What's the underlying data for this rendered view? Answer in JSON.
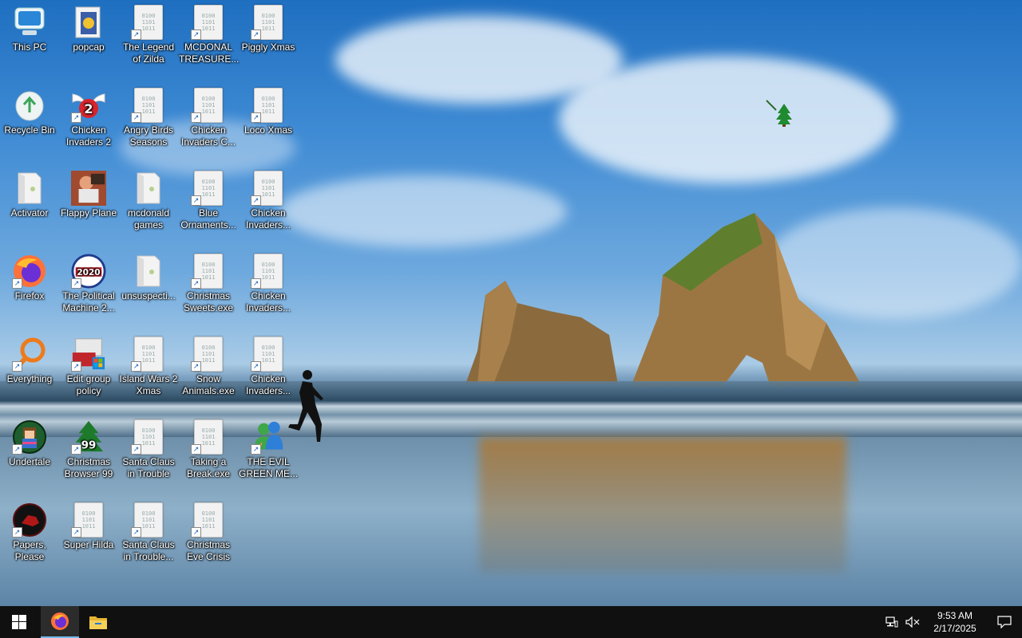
{
  "desktop": {
    "icons": [
      {
        "label": "This PC",
        "kind": "pc"
      },
      {
        "label": "popcap",
        "kind": "popcap"
      },
      {
        "label": "The Legend of Zilda",
        "kind": "bin"
      },
      {
        "label": "MCDONAL TREASURE...",
        "kind": "bin"
      },
      {
        "label": "Piggly Xmas",
        "kind": "bin"
      },
      {
        "label": "Recycle Bin",
        "kind": "recycle"
      },
      {
        "label": "Chicken Invaders 2",
        "kind": "chicken"
      },
      {
        "label": "Angry Birds Seasons",
        "kind": "bin"
      },
      {
        "label": "Chicken Invaders C...",
        "kind": "bin"
      },
      {
        "label": "Loco Xmas",
        "kind": "bin"
      },
      {
        "label": "Activator",
        "kind": "folder"
      },
      {
        "label": "Flappy Plane",
        "kind": "photo"
      },
      {
        "label": "mcdonald games",
        "kind": "folder"
      },
      {
        "label": "Blue Ornaments...",
        "kind": "bin"
      },
      {
        "label": "Chicken Invaders...",
        "kind": "bin"
      },
      {
        "label": "Firefox",
        "kind": "firefox"
      },
      {
        "label": "The Political Machine 2...",
        "kind": "political"
      },
      {
        "label": "unsuspecti...",
        "kind": "folder"
      },
      {
        "label": "Christmas Sweets.exe",
        "kind": "bin"
      },
      {
        "label": "Chicken Invaders...",
        "kind": "bin"
      },
      {
        "label": "Everything",
        "kind": "everything"
      },
      {
        "label": "Edit group policy",
        "kind": "policy"
      },
      {
        "label": "Island Wars 2 Xmas",
        "kind": "bin"
      },
      {
        "label": "Snow Animals.exe",
        "kind": "bin"
      },
      {
        "label": "Chicken Invaders...",
        "kind": "bin"
      },
      {
        "label": "Undertale",
        "kind": "undertale"
      },
      {
        "label": "Christmas Browser 99",
        "kind": "xmastree"
      },
      {
        "label": "Santa Claus in Trouble",
        "kind": "bin"
      },
      {
        "label": "Taking a Break.exe",
        "kind": "bin"
      },
      {
        "label": "THE EVIL GREEN ME...",
        "kind": "messenger"
      },
      {
        "label": "Papers, Please",
        "kind": "papers"
      },
      {
        "label": "Super Hilda",
        "kind": "bin"
      },
      {
        "label": "Santa Claus in Trouble...",
        "kind": "bin"
      },
      {
        "label": "Christmas Eve Crisis",
        "kind": "bin"
      }
    ],
    "binary_text": [
      "0100",
      "1101",
      "1011"
    ],
    "political_year": "2020",
    "xmas_number": "99"
  },
  "taskbar": {
    "time": "9:53 AM",
    "date": "2/17/2025"
  },
  "colors": {
    "taskbar_bg": "#101010",
    "active_underline": "#76b9ed"
  }
}
